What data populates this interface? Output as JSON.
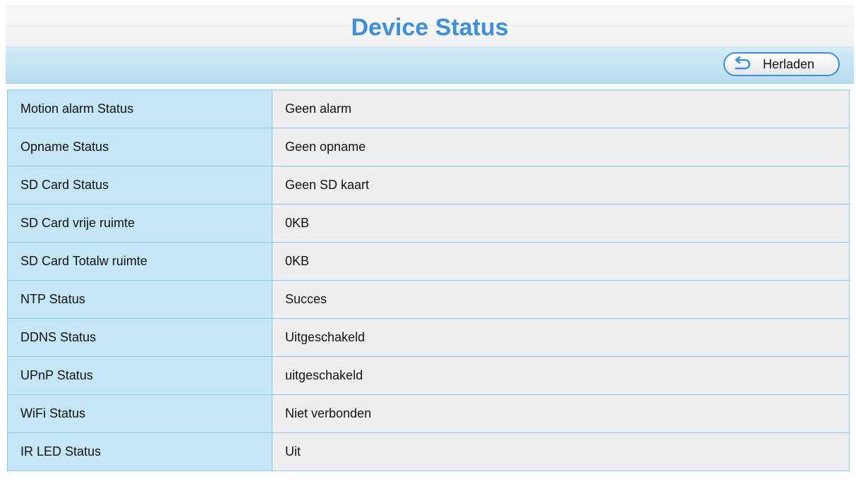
{
  "header": {
    "title": "Device Status"
  },
  "toolbar": {
    "reload_label": "Herladen",
    "reload_icon": "undo-arrow-icon"
  },
  "status_rows": [
    {
      "label": "Motion alarm Status",
      "value": "Geen alarm"
    },
    {
      "label": "Opname Status",
      "value": "Geen opname"
    },
    {
      "label": "SD Card Status",
      "value": "Geen SD kaart"
    },
    {
      "label": "SD Card vrije ruimte",
      "value": "0KB"
    },
    {
      "label": "SD Card Totalw ruimte",
      "value": "0KB"
    },
    {
      "label": "NTP Status",
      "value": "Succes"
    },
    {
      "label": "DDNS Status",
      "value": "Uitgeschakeld"
    },
    {
      "label": "UPnP Status",
      "value": "uitgeschakeld"
    },
    {
      "label": "WiFi Status",
      "value": "Niet verbonden"
    },
    {
      "label": "IR LED Status",
      "value": "Uit"
    }
  ],
  "colors": {
    "title": "#3f8fd8",
    "label_cell_bg": "#c5e6f7",
    "value_cell_bg": "#eeeeee",
    "border": "#8fc6e6"
  }
}
